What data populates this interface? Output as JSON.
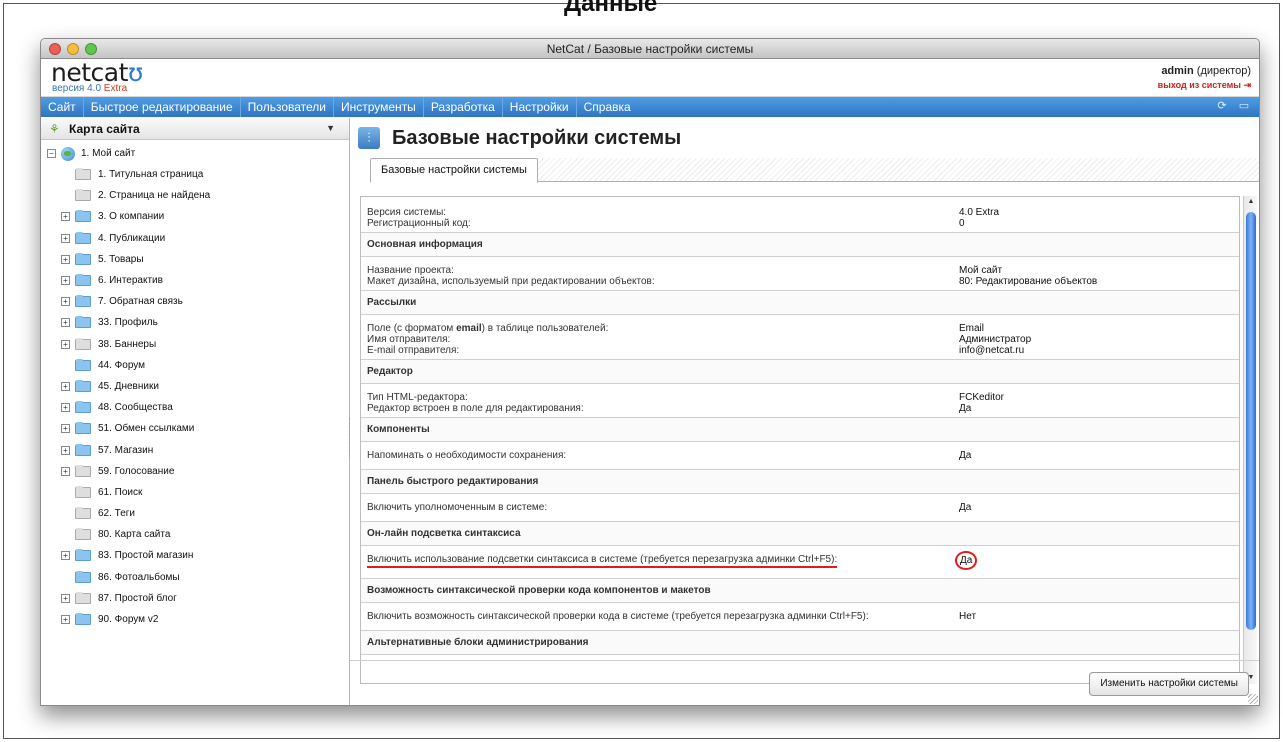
{
  "page": {
    "top_heading": "Данные"
  },
  "window": {
    "title": "NetCat / Базовые настройки системы"
  },
  "header": {
    "logo_text": "netcat",
    "version_label": "версия 4.0",
    "version_edition": "Extra",
    "user_name": "admin",
    "user_role": "(директор)",
    "logout_label": "выход из системы"
  },
  "menu": {
    "items": [
      "Сайт",
      "Быстрое редактирование",
      "Пользователи",
      "Инструменты",
      "Разработка",
      "Настройки",
      "Справка"
    ]
  },
  "sidebar": {
    "title": "Карта сайта",
    "root_label": "1. Мой сайт",
    "items": [
      {
        "label": "1. Титульная страница",
        "expandable": false,
        "folder": "gray"
      },
      {
        "label": "2. Страница не найдена",
        "expandable": false,
        "folder": "gray"
      },
      {
        "label": "3. О компании",
        "expandable": true,
        "folder": "blue"
      },
      {
        "label": "4. Публикации",
        "expandable": true,
        "folder": "blue"
      },
      {
        "label": "5. Товары",
        "expandable": true,
        "folder": "blue"
      },
      {
        "label": "6. Интерактив",
        "expandable": true,
        "folder": "blue"
      },
      {
        "label": "7. Обратная связь",
        "expandable": true,
        "folder": "blue"
      },
      {
        "label": "33. Профиль",
        "expandable": true,
        "folder": "blue"
      },
      {
        "label": "38. Баннеры",
        "expandable": true,
        "folder": "gray"
      },
      {
        "label": "44. Форум",
        "expandable": false,
        "folder": "blue"
      },
      {
        "label": "45. Дневники",
        "expandable": true,
        "folder": "blue"
      },
      {
        "label": "48. Сообщества",
        "expandable": true,
        "folder": "blue"
      },
      {
        "label": "51. Обмен ссылками",
        "expandable": true,
        "folder": "blue"
      },
      {
        "label": "57. Магазин",
        "expandable": true,
        "folder": "blue"
      },
      {
        "label": "59. Голосование",
        "expandable": true,
        "folder": "gray"
      },
      {
        "label": "61. Поиск",
        "expandable": false,
        "folder": "gray"
      },
      {
        "label": "62. Теги",
        "expandable": false,
        "folder": "gray"
      },
      {
        "label": "80. Карта сайта",
        "expandable": false,
        "folder": "gray"
      },
      {
        "label": "83. Простой магазин",
        "expandable": true,
        "folder": "blue"
      },
      {
        "label": "86. Фотоальбомы",
        "expandable": false,
        "folder": "blue"
      },
      {
        "label": "87. Простой блог",
        "expandable": true,
        "folder": "gray"
      },
      {
        "label": "90. Форум v2",
        "expandable": true,
        "folder": "blue"
      }
    ]
  },
  "main": {
    "title": "Базовые настройки системы",
    "tab_label": "Базовые настройки системы",
    "save_button": "Изменить настройки системы",
    "system": {
      "version_label": "Версия системы:",
      "version_value": "4.0 Extra",
      "regcode_label": "Регистрационный код:",
      "regcode_value": "0"
    },
    "sections": {
      "basic": {
        "title": "Основная информация",
        "project_label": "Название проекта:",
        "project_value": "Мой сайт",
        "design_label": "Макет дизайна, используемый при редактировании объектов:",
        "design_value": "80: Редактирование объектов"
      },
      "mailing": {
        "title": "Рассылки",
        "field_label_pre": "Поле (с форматом ",
        "field_label_bold": "email",
        "field_label_post": ") в таблице пользователей:",
        "field_value": "Email",
        "sender_label": "Имя отправителя:",
        "sender_value": "Администратор",
        "sender_email_label": "E-mail отправителя:",
        "sender_email_value": "info@netcat.ru"
      },
      "editor": {
        "title": "Редактор",
        "type_label": "Тип HTML-редактора:",
        "type_value": "FCKeditor",
        "inline_label": "Редактор встроен в поле для редактирования:",
        "inline_value": "Да"
      },
      "components": {
        "title": "Компоненты",
        "remind_label": "Напоминать о необходимости сохранения:",
        "remind_value": "Да"
      },
      "quick_edit": {
        "title": "Панель быстрого редактирования",
        "enable_label": "Включить уполномоченным в системе:",
        "enable_value": "Да"
      },
      "highlight": {
        "title": "Он-лайн подсветка синтаксиса",
        "enable_label": "Включить использование подсветки синтаксиса в системе (требуется перезагрузка админки Ctrl+F5):",
        "enable_value": "Да"
      },
      "syntax_check": {
        "title": "Возможность синтаксической проверки кода компонентов и макетов",
        "enable_label": "Включить возможность синтаксической проверки кода в системе (требуется перезагрузка админки Ctrl+F5):",
        "enable_value": "Нет"
      },
      "alt_blocks": {
        "title": "Альтернативные блоки администрирования"
      }
    }
  },
  "colors": {
    "menu_blue": "#2f74c2",
    "accent_red": "#e51b1b",
    "scroll_blue": "#3a7ae0"
  }
}
